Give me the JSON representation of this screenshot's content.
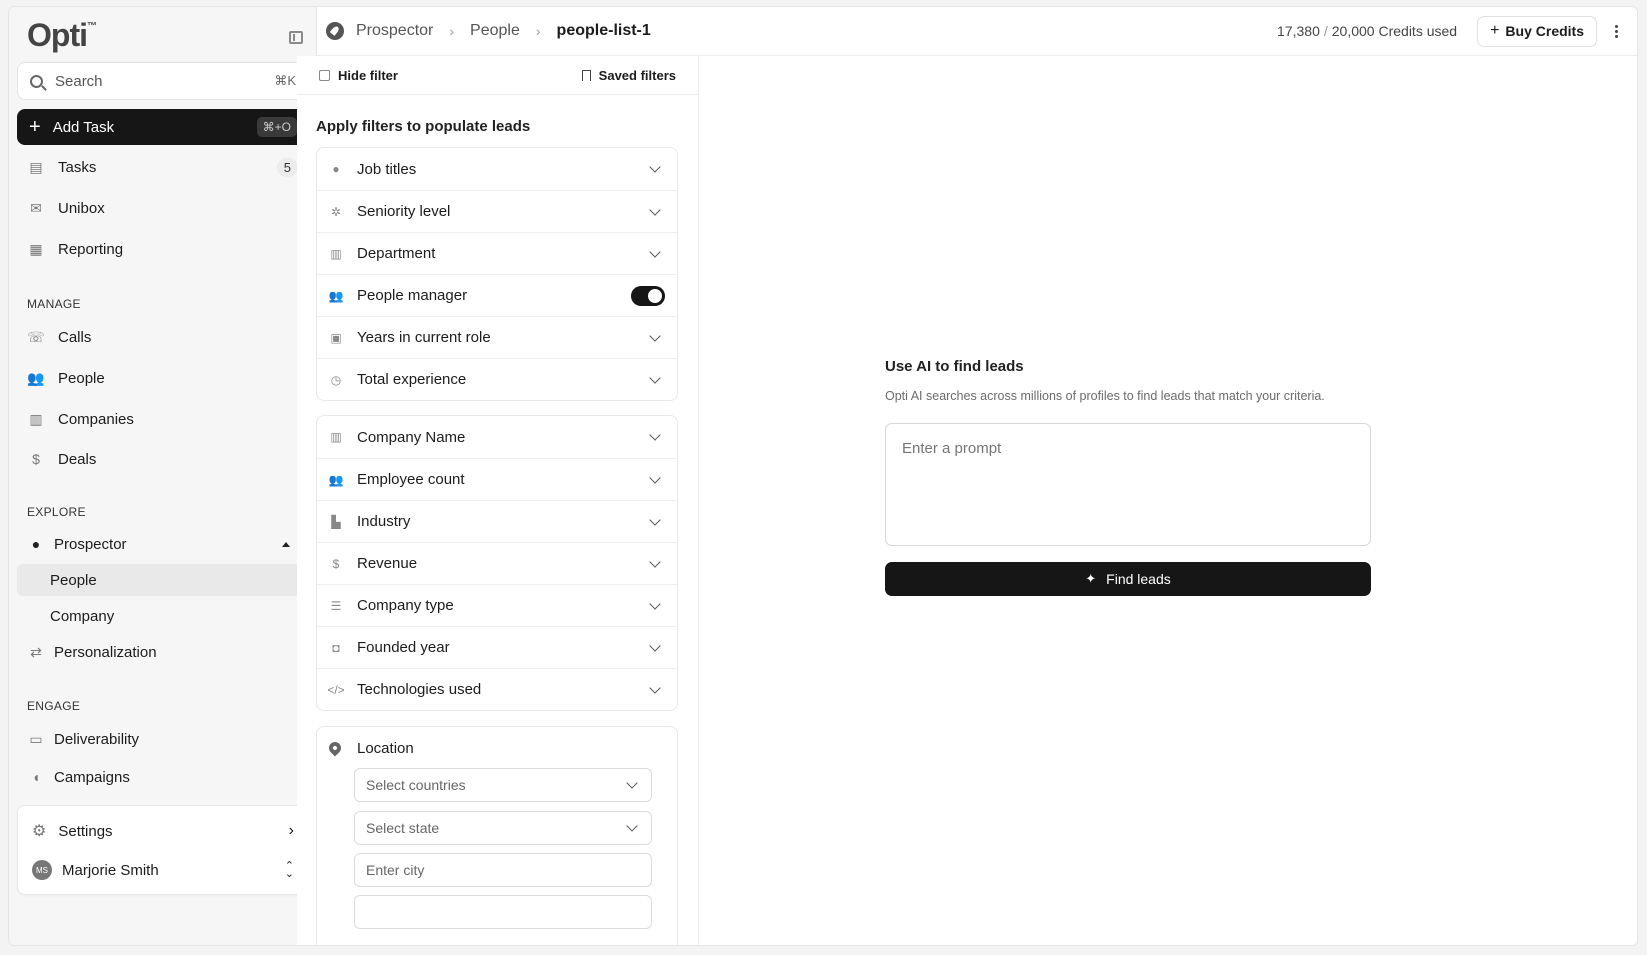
{
  "brand": {
    "name": "Opti"
  },
  "sidebar": {
    "search_label": "Search",
    "search_kbd": "⌘K",
    "add_task_label": "Add Task",
    "add_task_kbd": "⌘+O",
    "items": [
      {
        "label": "Tasks",
        "icon": "list-icon",
        "count": "5"
      },
      {
        "label": "Unibox",
        "icon": "mail-icon"
      },
      {
        "label": "Reporting",
        "icon": "report-icon"
      }
    ],
    "manage_label": "MANAGE",
    "manage_items": [
      {
        "label": "Calls",
        "icon": "phone-icon"
      },
      {
        "label": "People",
        "icon": "people-icon"
      },
      {
        "label": "Companies",
        "icon": "building-icon"
      },
      {
        "label": "Deals",
        "icon": "dollar-icon"
      }
    ],
    "explore_label": "EXPLORE",
    "explore_items": [
      {
        "label": "Prospector",
        "icon": "compass-icon"
      },
      {
        "label": "People"
      },
      {
        "label": "Company"
      },
      {
        "label": "Personalization",
        "icon": "sliders-icon"
      }
    ],
    "engage_label": "ENGAGE",
    "engage_items": [
      {
        "label": "Deliverability",
        "icon": "inbox-icon"
      },
      {
        "label": "Campaigns",
        "icon": "megaphone-icon"
      }
    ],
    "settings_label": "Settings",
    "user": {
      "name": "Marjorie Smith",
      "initials": "MS"
    }
  },
  "topbar": {
    "crumbs": [
      "Prospector",
      "People",
      "people-list-1"
    ],
    "credits_used": "17,380",
    "credits_total": "20,000 Credits used",
    "buy_label": "Buy Credits"
  },
  "filters": {
    "hide_label": "Hide filter",
    "saved_label": "Saved filters",
    "title": "Apply filters to populate leads",
    "person": [
      {
        "label": "Job titles"
      },
      {
        "label": "Seniority level"
      },
      {
        "label": "Department"
      },
      {
        "label": "People manager"
      },
      {
        "label": "Years in current role"
      },
      {
        "label": "Total experience"
      }
    ],
    "company": [
      {
        "label": "Company Name"
      },
      {
        "label": "Employee count"
      },
      {
        "label": "Industry"
      },
      {
        "label": "Revenue"
      },
      {
        "label": "Company type"
      },
      {
        "label": "Founded year"
      },
      {
        "label": "Technologies used"
      }
    ],
    "location": {
      "label": "Location",
      "countries_placeholder": "Select countries",
      "state_placeholder": "Select state",
      "city_placeholder": "Enter city"
    }
  },
  "ai": {
    "title": "Use AI to find leads",
    "description": "Opti AI searches across millions of profiles to find leads that match your criteria.",
    "prompt_placeholder": "Enter a prompt",
    "button_label": "Find leads"
  }
}
